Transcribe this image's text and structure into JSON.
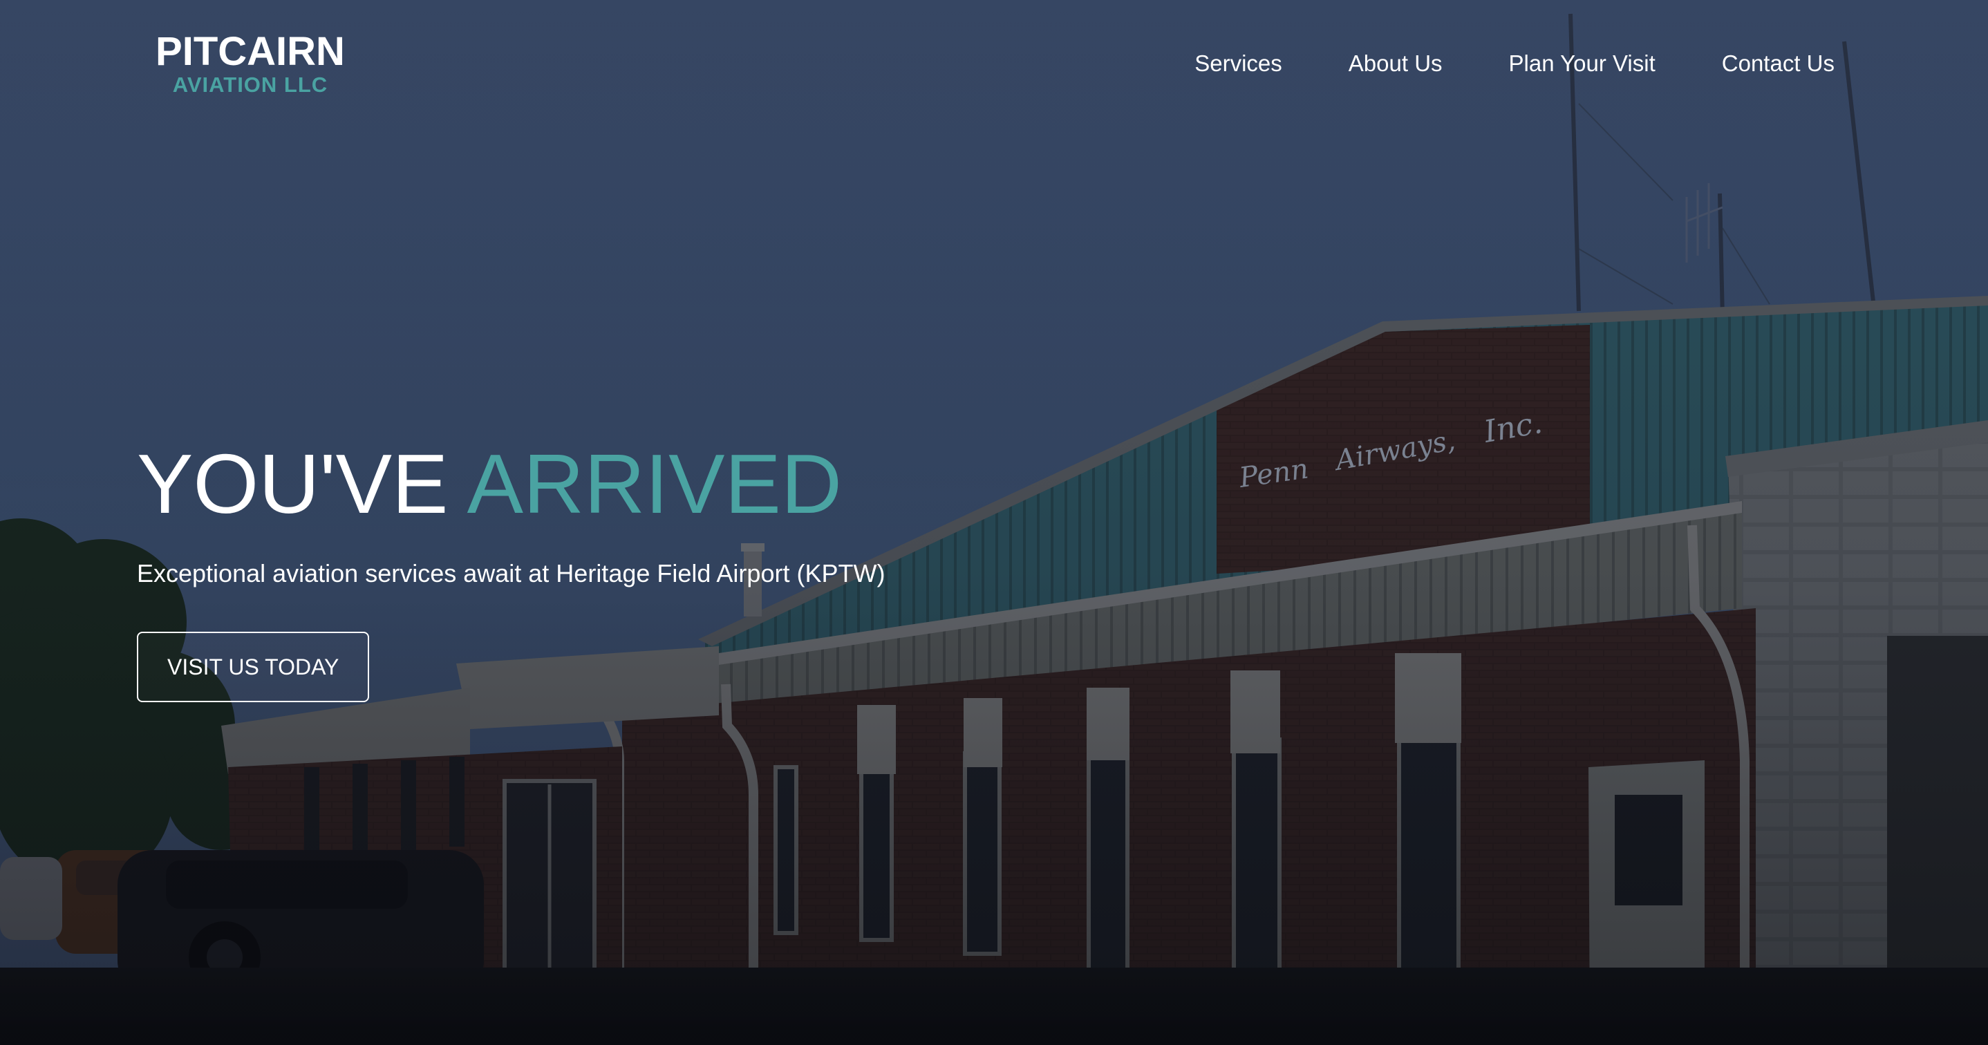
{
  "logo": {
    "main": "PITCAIRN",
    "sub": "AVIATION LLC"
  },
  "nav": {
    "items": [
      {
        "label": "Services"
      },
      {
        "label": "About Us"
      },
      {
        "label": "Plan Your Visit"
      },
      {
        "label": "Contact Us"
      }
    ]
  },
  "hero": {
    "title_part1": "YOU'VE",
    "title_part2": "ARRIVED",
    "subtitle": "Exceptional aviation services await at Heritage Field Airport (KPTW)",
    "cta_label": "VISIT US TODAY",
    "building_sign": "Penn Airways, Inc."
  },
  "colors": {
    "accent": "#4aa3a2",
    "sky": "#3b4f70",
    "text": "#ffffff"
  }
}
